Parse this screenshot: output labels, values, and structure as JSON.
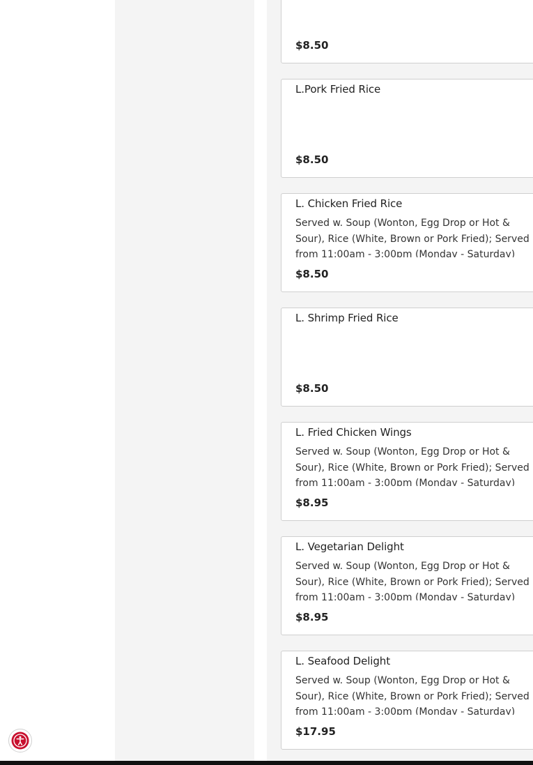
{
  "menu": {
    "items": [
      {
        "name": "",
        "description": "",
        "price": "$8.50"
      },
      {
        "name": "L.Pork Fried Rice",
        "description": "",
        "price": "$8.50"
      },
      {
        "name": "L. Chicken Fried Rice",
        "description": "Served w. Soup (Wonton, Egg Drop or Hot & Sour), Rice (White, Brown or Pork Fried); Served from 11:00am - 3:00pm (Monday - Saturday)",
        "price": "$8.50"
      },
      {
        "name": "L. Shrimp Fried Rice",
        "description": "",
        "price": "$8.50"
      },
      {
        "name": "L. Fried Chicken Wings",
        "description": "Served w. Soup (Wonton, Egg Drop or Hot & Sour), Rice (White, Brown or Pork Fried); Served from 11:00am - 3:00pm (Monday - Saturday)",
        "price": "$8.95"
      },
      {
        "name": "L. Vegetarian Delight",
        "description": "Served w. Soup (Wonton, Egg Drop or Hot & Sour), Rice (White, Brown or Pork Fried); Served from 11:00am - 3:00pm (Monday - Saturday)",
        "price": "$8.95"
      },
      {
        "name": "L. Seafood Delight",
        "description": "Served w. Soup (Wonton, Egg Drop or Hot & Sour), Rice (White, Brown or Pork Fried); Served from 11:00am - 3:00pm (Monday - Saturday)",
        "price": "$17.95"
      }
    ]
  },
  "accessibility": {
    "icon": "accessibility-icon",
    "color": "#c8102e"
  },
  "colors": {
    "panel": "#f4f4f4",
    "card_border": "#cfcfcf",
    "text": "#222222"
  }
}
